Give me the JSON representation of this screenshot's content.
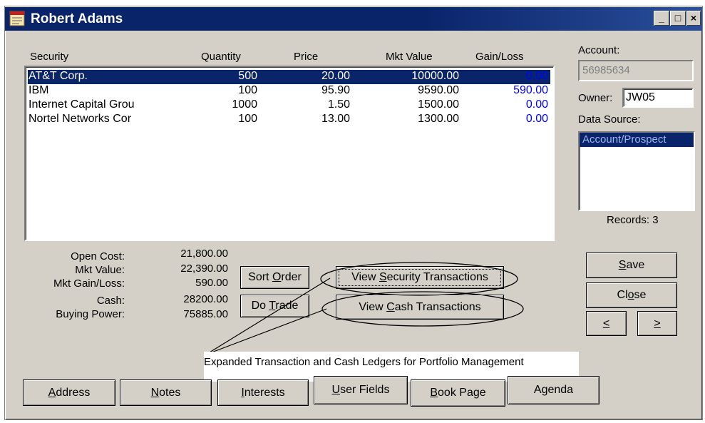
{
  "window": {
    "title": "Robert Adams",
    "controls": [
      "_",
      "□",
      "×"
    ]
  },
  "table": {
    "headers": [
      "Security",
      "Quantity",
      "Price",
      "Mkt Value",
      "Gain/Loss"
    ],
    "rows": [
      {
        "security": "AT&T Corp.",
        "quantity": "500",
        "price": "20.00",
        "mkt_value": "10000.00",
        "gain_loss": "0.00",
        "selected": true
      },
      {
        "security": "IBM",
        "quantity": "100",
        "price": "95.90",
        "mkt_value": "9590.00",
        "gain_loss": "590.00"
      },
      {
        "security": "Internet Capital Grou",
        "quantity": "1000",
        "price": "1.50",
        "mkt_value": "1500.00",
        "gain_loss": "0.00"
      },
      {
        "security": "Nortel Networks Cor",
        "quantity": "100",
        "price": "13.00",
        "mkt_value": "1300.00",
        "gain_loss": "0.00"
      }
    ]
  },
  "account": {
    "account_label": "Account:",
    "account_value": "56985634",
    "owner_label": "Owner:",
    "owner_value": "JW05",
    "data_source_label": "Data Source:",
    "data_source_items": [
      "Account/Prospect"
    ],
    "records": "Records: 3"
  },
  "summary": [
    {
      "label": "Open Cost:",
      "value": "21,800.00"
    },
    {
      "label": "Mkt Value:",
      "value": "22,390.00"
    },
    {
      "label": "Mkt Gain/Loss:",
      "value": "590.00"
    },
    {
      "label": "Cash:",
      "value": "28200.00"
    },
    {
      "label": "Buying Power:",
      "value": "75885.00"
    }
  ],
  "buttons": {
    "sort_order": {
      "pre": "Sort ",
      "u": "O",
      "post": "rder"
    },
    "do_trade": {
      "pre": "Do ",
      "u": "T",
      "post": "rade"
    },
    "view_security": {
      "pre": "View ",
      "u": "S",
      "post": "ecurity Transactions"
    },
    "view_cash": {
      "pre": "View ",
      "u": "C",
      "post": "ash Transactions"
    },
    "save": {
      "pre": "",
      "u": "S",
      "post": "ave"
    },
    "close": {
      "pre": "Cl",
      "u": "o",
      "post": "se"
    },
    "prev": {
      "pre": "",
      "u": "<",
      "post": ""
    },
    "next": {
      "pre": "",
      "u": ">",
      "post": ""
    }
  },
  "bottom_tabs": [
    {
      "pre": "",
      "u": "A",
      "post": "ddress"
    },
    {
      "pre": "",
      "u": "N",
      "post": "otes"
    },
    {
      "pre": "",
      "u": "I",
      "post": "nterests"
    },
    {
      "pre": "",
      "u": "U",
      "post": "ser Fields"
    },
    {
      "pre": "",
      "u": "B",
      "post": "ook Page"
    },
    {
      "pre": "Agenda",
      "u": "",
      "post": ""
    }
  ],
  "annotation": "Expanded Transaction and Cash Ledgers for Portfolio Management",
  "colors": {
    "title_bar": "#0a246a",
    "face": "#d4d0c8",
    "selection": "#0a246a",
    "gain_text": "#0000ff"
  }
}
